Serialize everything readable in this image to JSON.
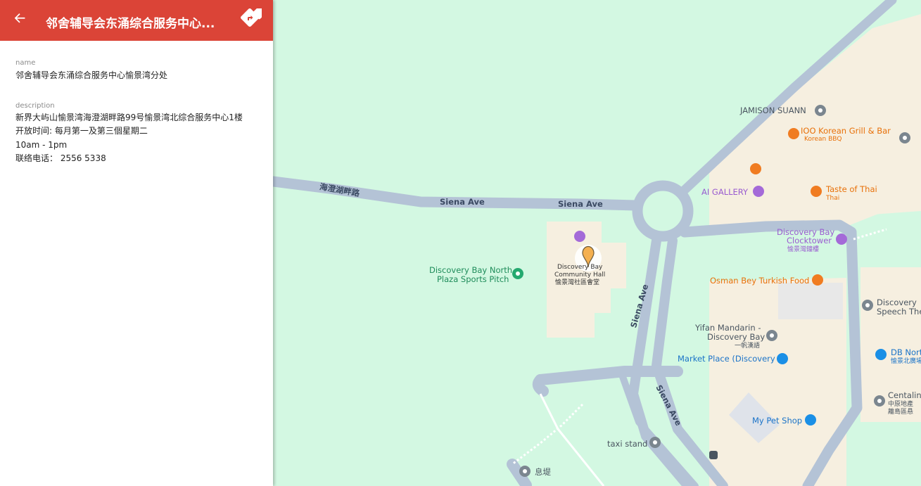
{
  "header": {
    "title": "邻舍辅导会东涌综合服务中心...",
    "back_icon": "arrow-back-icon",
    "directions_icon": "directions-icon",
    "color": "#db4437"
  },
  "details": {
    "name_label": "name",
    "name_value": "邻舍辅导会东涌综合服务中心愉景湾分处",
    "description_label": "description",
    "description_lines": [
      "新界大屿山愉景湾海澄湖畔路99号愉景湾北综合服务中心1楼",
      "开放时间: 每月第一及第三個星期二",
      "10am - 1pm",
      "联络电话： 2556 5338"
    ]
  },
  "map": {
    "colors": {
      "land": "#d3f8e2",
      "road": "#b4c3d6",
      "building": "#f6efe0"
    },
    "road_labels": {
      "hoi_ching": "海澄湖畔路",
      "siena_1": "Siena Ave",
      "siena_2": "Siena Ave",
      "siena_3": "Siena Ave",
      "siena_4": "Siena Ave"
    },
    "pois": {
      "jamison": "JAMISON SUANN",
      "ioo_1": "IOO Korean Grill & Bar",
      "ioo_2": "Korean BBQ",
      "ai_gallery": "AI GALLERY",
      "taste_1": "Taste of Thai",
      "taste_2": "Thai",
      "clock_1": "Discovery Bay",
      "clock_2": "Clocktower",
      "clock_3": "愉景灣鐘樓",
      "hall_1": "Discovery Bay",
      "hall_2": "Community Hall",
      "hall_3": "愉景灣社區會堂",
      "pitch_1": "Discovery Bay North",
      "pitch_2": "Plaza Sports Pitch",
      "osman": "Osman Bey Turkish Food",
      "yifan_1": "Yifan Mandarin -",
      "yifan_2": "Discovery Bay",
      "yifan_3": "一帆漢語",
      "market": "Market Place (Discovery",
      "speech_1": "Discovery",
      "speech_2": "Speech The",
      "dbnorth_1": "DB Nort",
      "dbnorth_2": "愉景北廣場",
      "centaline_1": "Centalin",
      "centaline_2": "中原地產",
      "centaline_3": "離島區悬",
      "pet": "My Pet Shop",
      "taxi": "taxi stand",
      "pier": "息堤"
    }
  }
}
